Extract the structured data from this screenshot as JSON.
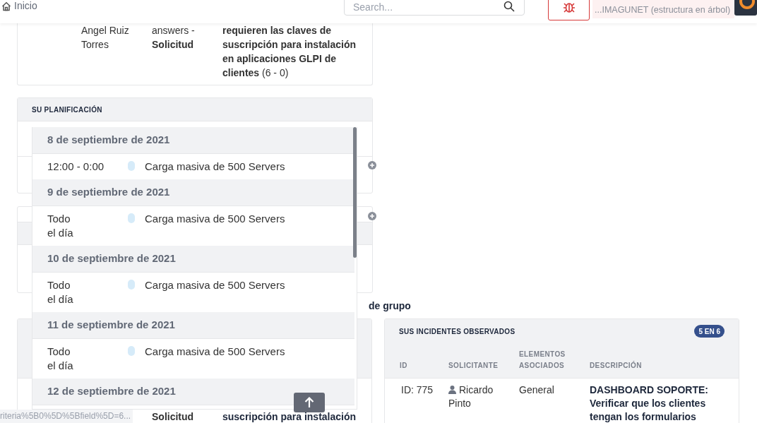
{
  "topbar": {
    "breadcrumb": "Inicio",
    "search": {
      "placeholder": "Search..."
    },
    "user": {
      "entity": "...IMAGUNET (estructura en árbol)"
    }
  },
  "top_card": {
    "row": {
      "requester": "Angel Ruiz Torres",
      "items": "answers - **Solicitud**",
      "description": "**requieren las claves de suscripción para instalación en aplicaciones GLPI de clientes** (6 - 0)"
    }
  },
  "planning": {
    "title": "SU PLANIFICACIÓN"
  },
  "group_heading": "de grupo",
  "left_table": {
    "rows": [
      {
        "items": "Solicitud",
        "description": "suscripción para instalación"
      }
    ]
  },
  "watched": {
    "title": "SUS INCIDENTES OBSERVADOS",
    "badge": "5 EN 6",
    "columns": [
      "ID",
      "SOLICITANTE",
      "ELEMENTOS ASOCIADOS",
      "DESCRIPCIÓN"
    ],
    "rows": [
      {
        "id": "ID: 775",
        "requester": "Ricardo Pinto",
        "items": "General",
        "description": "DASHBOARD SOPORTE: Verificar que los clientes tengan los formularios"
      }
    ]
  },
  "planning_list": [
    {
      "date": "8 de septiembre de 2021",
      "events": [
        {
          "kind": "timed",
          "time": "12:00 - 0:00",
          "title": "Carga masiva de 500 Servers"
        }
      ]
    },
    {
      "date": "9 de septiembre de 2021",
      "events": [
        {
          "kind": "all_day",
          "time": "Todo el día",
          "title": "Carga masiva de 500 Servers"
        }
      ]
    },
    {
      "date": "10 de septiembre de 2021",
      "events": [
        {
          "kind": "all_day",
          "time": "Todo el día",
          "title": "Carga masiva de 500 Servers"
        }
      ]
    },
    {
      "date": "11 de septiembre de 2021",
      "events": [
        {
          "kind": "all_day",
          "time": "Todo el día",
          "title": "Carga masiva de 500 Servers"
        }
      ]
    },
    {
      "date": "12 de septiembre de 2021"
    }
  ],
  "status_url": "riteria%5B0%5D%5Bfield%5D=6..."
}
